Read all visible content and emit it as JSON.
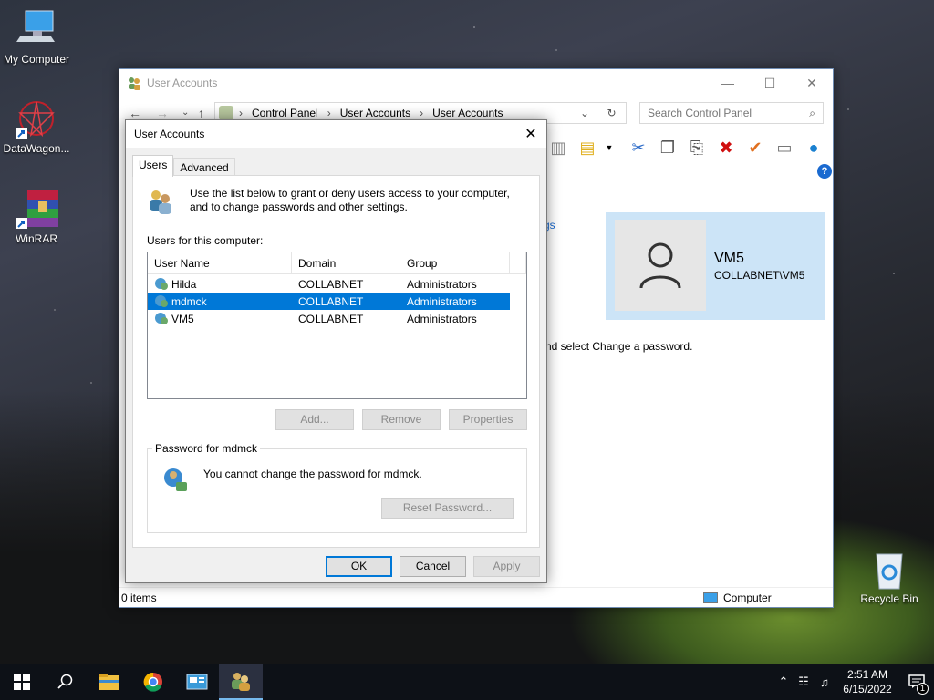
{
  "desktop": {
    "icons": [
      {
        "label": "My Computer"
      },
      {
        "label": "DataWagon..."
      },
      {
        "label": "WinRAR"
      },
      {
        "label": "Recycle Bin"
      }
    ]
  },
  "explorer": {
    "title": "User Accounts",
    "breadcrumb": [
      "Control Panel",
      "User Accounts",
      "User Accounts"
    ],
    "search_placeholder": "Search Control Panel",
    "partial_link": "gs",
    "partial_text": "nd select Change a password.",
    "profile": {
      "name": "VM5",
      "account": "COLLABNET\\VM5"
    },
    "status_left": "0 items",
    "status_right": "Computer"
  },
  "dialog": {
    "title": "User Accounts",
    "tabs": [
      "Users",
      "Advanced"
    ],
    "intro": "Use the list below to grant or deny users access to your computer, and to change passwords and other settings.",
    "users_label": "Users for this computer:",
    "columns": [
      "User Name",
      "Domain",
      "Group"
    ],
    "rows": [
      {
        "user": "Hilda",
        "domain": "COLLABNET",
        "group": "Administrators"
      },
      {
        "user": "mdmck",
        "domain": "COLLABNET",
        "group": "Administrators"
      },
      {
        "user": "VM5",
        "domain": "COLLABNET",
        "group": "Administrators"
      }
    ],
    "buttons": {
      "add": "Add...",
      "remove": "Remove",
      "properties": "Properties",
      "reset": "Reset Password...",
      "ok": "OK",
      "cancel": "Cancel",
      "apply": "Apply"
    },
    "password_group": "Password for mdmck",
    "password_msg": "You cannot change the password for mdmck."
  },
  "taskbar": {
    "time": "2:51 AM",
    "date": "6/15/2022",
    "notification_count": "1"
  }
}
